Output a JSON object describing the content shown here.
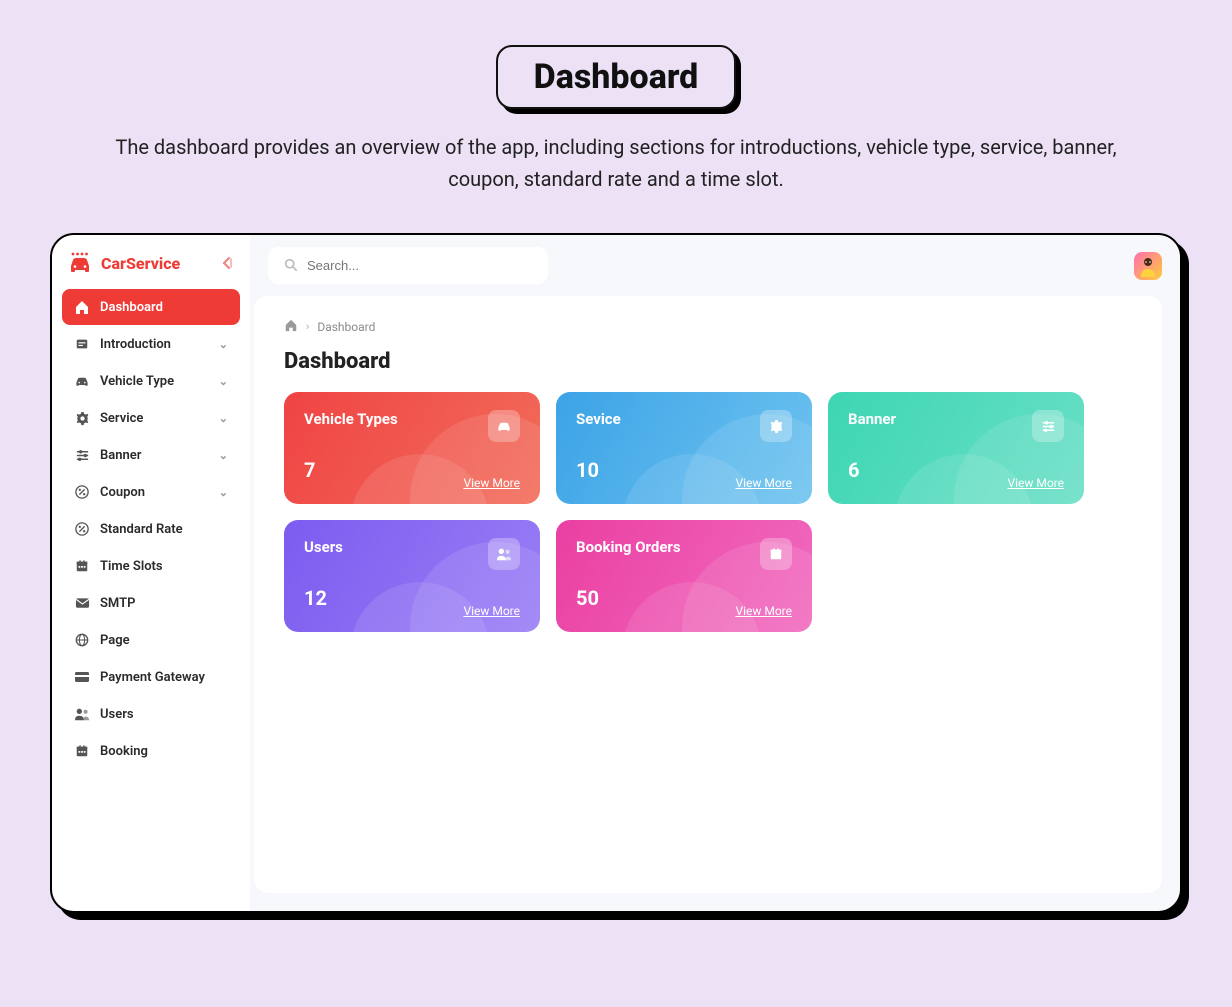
{
  "hero": {
    "title": "Dashboard",
    "subtitle": "The dashboard provides an overview of the app, including sections for introductions, vehicle type, service, banner, coupon, standard rate and a time slot."
  },
  "brand": {
    "name": "CarService"
  },
  "search": {
    "placeholder": "Search..."
  },
  "nav": {
    "items": [
      {
        "label": "Dashboard",
        "icon": "home-icon",
        "active": true,
        "expandable": false
      },
      {
        "label": "Introduction",
        "icon": "intro-icon",
        "active": false,
        "expandable": true
      },
      {
        "label": "Vehicle Type",
        "icon": "car-icon",
        "active": false,
        "expandable": true
      },
      {
        "label": "Service",
        "icon": "gear-icon",
        "active": false,
        "expandable": true
      },
      {
        "label": "Banner",
        "icon": "sliders-icon",
        "active": false,
        "expandable": true
      },
      {
        "label": "Coupon",
        "icon": "percent-icon",
        "active": false,
        "expandable": true
      },
      {
        "label": "Standard Rate",
        "icon": "percent-icon",
        "active": false,
        "expandable": false
      },
      {
        "label": "Time Slots",
        "icon": "calendar-icon",
        "active": false,
        "expandable": false
      },
      {
        "label": "SMTP",
        "icon": "envelope-icon",
        "active": false,
        "expandable": false
      },
      {
        "label": "Page",
        "icon": "globe-icon",
        "active": false,
        "expandable": false
      },
      {
        "label": "Payment Gateway",
        "icon": "credit-card-icon",
        "active": false,
        "expandable": false
      },
      {
        "label": "Users",
        "icon": "users-icon",
        "active": false,
        "expandable": false
      },
      {
        "label": "Booking",
        "icon": "calendar-icon",
        "active": false,
        "expandable": false
      }
    ]
  },
  "breadcrumb": {
    "current": "Dashboard"
  },
  "page": {
    "title": "Dashboard"
  },
  "cards": [
    {
      "title": "Vehicle Types",
      "count": "7",
      "link": "View More",
      "icon": "car-icon",
      "color": "c-red"
    },
    {
      "title": "Sevice",
      "count": "10",
      "link": "View More",
      "icon": "gear-icon",
      "color": "c-blue"
    },
    {
      "title": "Banner",
      "count": "6",
      "link": "View More",
      "icon": "sliders-icon",
      "color": "c-teal"
    },
    {
      "title": "Users",
      "count": "12",
      "link": "View More",
      "icon": "users-icon",
      "color": "c-purple"
    },
    {
      "title": "Booking Orders",
      "count": "50",
      "link": "View More",
      "icon": "calendar-icon",
      "color": "c-pink"
    }
  ]
}
